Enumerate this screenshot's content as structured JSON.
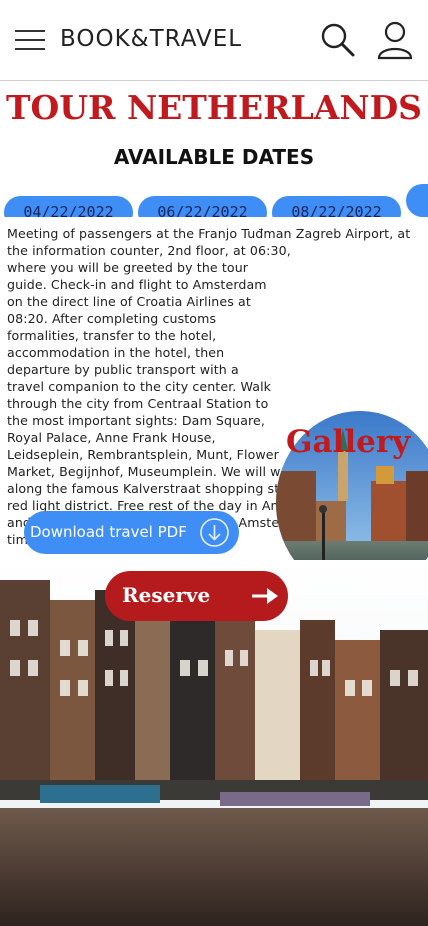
{
  "header": {
    "brand": "BOOK&TRAVEL",
    "menu_icon": "hamburger-menu-icon",
    "search_icon": "search-icon",
    "user_icon": "user-icon"
  },
  "page": {
    "title": "TOUR NETHERLANDS",
    "dates_heading": "AVAILABLE DATES",
    "dates": [
      "04/22/2022",
      "06/22/2022",
      "08/22/2022",
      ""
    ],
    "description": "Meeting of passengers at the Franjo Tuđman Zagreb Airport, at the information counter, 2nd floor, at 06:30, where you will be greeted by the tour guide. Check-in and flight to Amsterdam on the direct line of Croatia Airlines at 08:20. After completing customs formalities, transfer to the hotel, accommodation in the hotel, then departure by public transport with a travel companion to the city center. Walk through the city from Centraal Station to the most important sights: Dam Square, Royal Palace, Anne Frank House, Leidseplein, Rembrantsplein, Munt, Flower Market, Begijnhof, Museumplein. We will walk along the famous Kalverstraat shopping street and the famous red light district. Free rest of the day in Amsterdam for a walk and enjoy a coffee along one of the Amsterdam canals. Free time. Overnight stay."
  },
  "gallery": {
    "title": "Gallery",
    "arrow_icon": "arrow-right-icon"
  },
  "actions": {
    "pdf_label": "Download travel PDF",
    "pdf_icon": "download-icon",
    "reserve_label": "Reserve",
    "reserve_icon": "arrow-right-icon"
  },
  "colors": {
    "accent_red": "#c0191e",
    "button_blue": "#3f8ef5",
    "reserve_red": "#b51b1d"
  }
}
